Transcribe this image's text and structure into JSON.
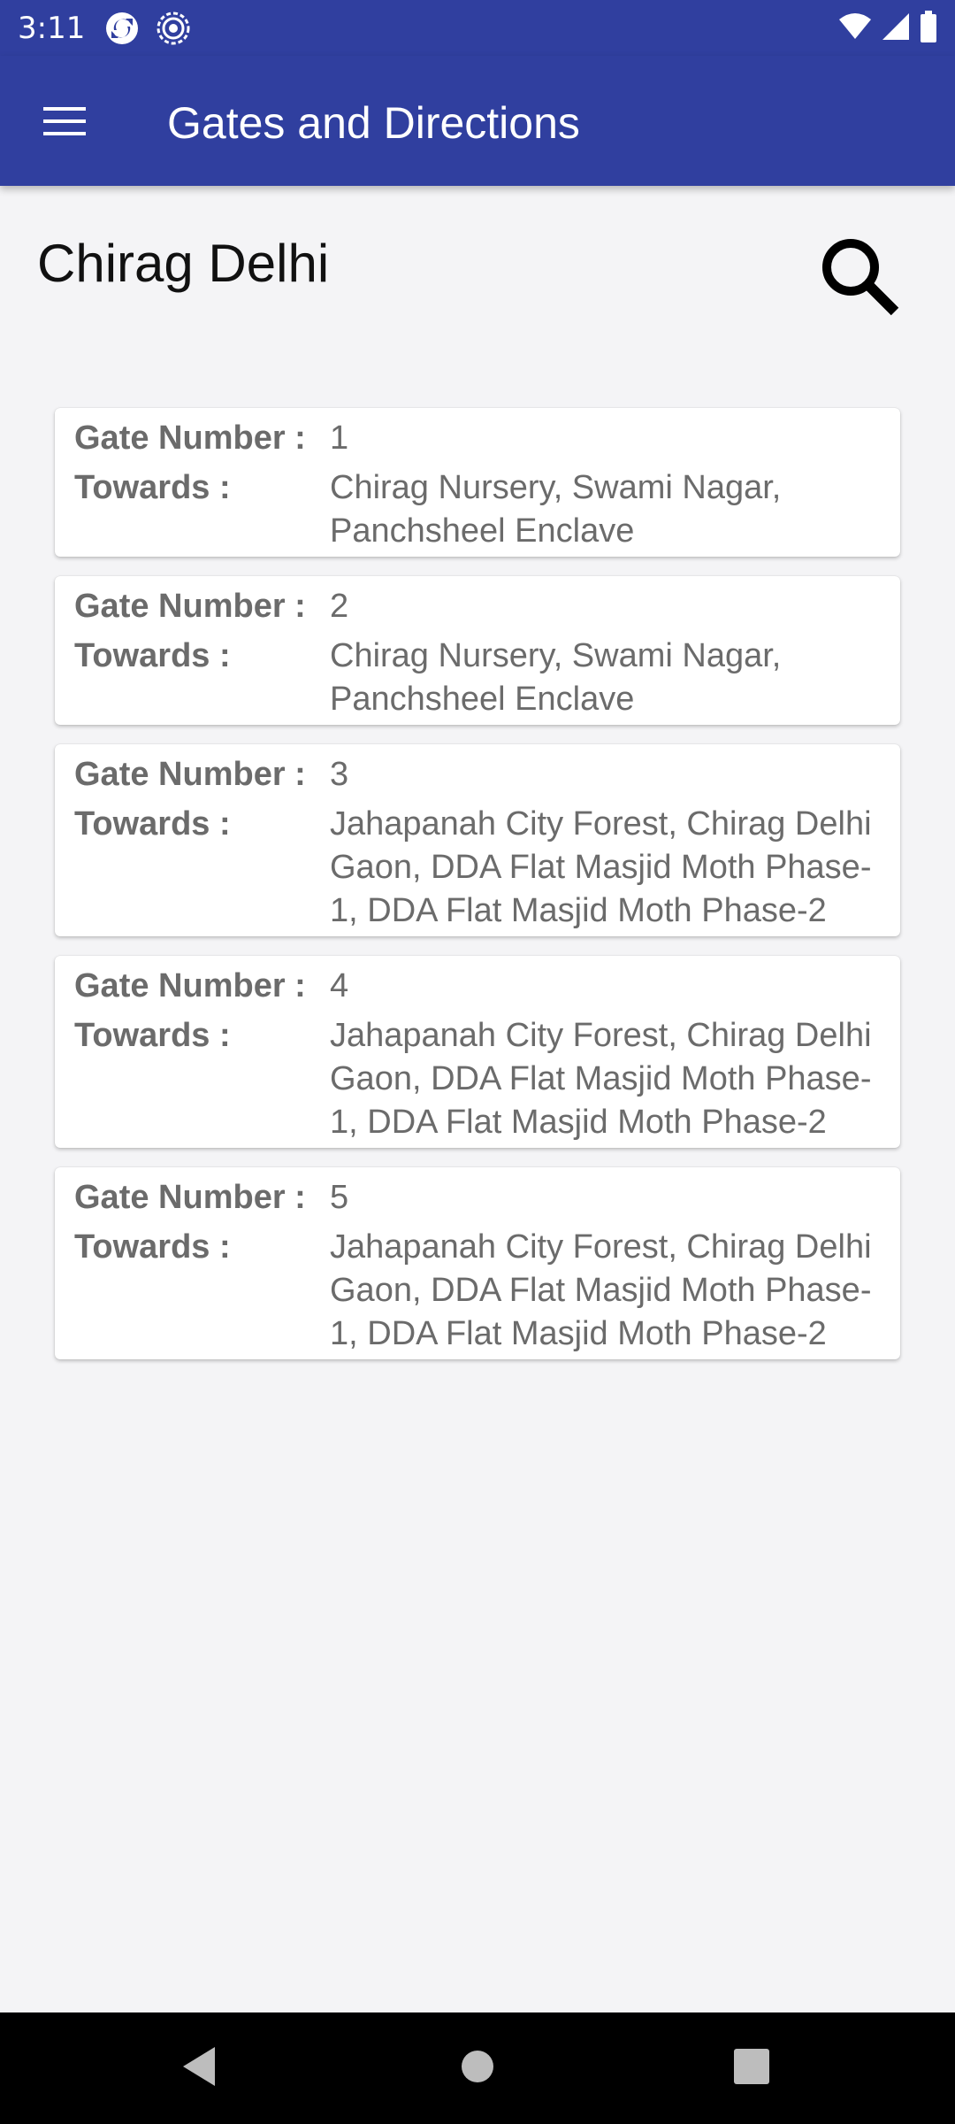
{
  "status_bar": {
    "time": "3:11",
    "left_icons": [
      "sync-icon",
      "settings-target-icon"
    ],
    "right_icons": [
      "wifi-icon",
      "signal-icon",
      "battery-icon"
    ]
  },
  "app_bar": {
    "title": "Gates and Directions",
    "menu_icon": "hamburger-menu-icon"
  },
  "station": {
    "name": "Chirag Delhi",
    "search_icon": "search-icon"
  },
  "labels": {
    "gate_number": "Gate Number :",
    "towards": "Towards :"
  },
  "gates": [
    {
      "number": "1",
      "towards": "Chirag Nursery, Swami Nagar, Panchsheel Enclave"
    },
    {
      "number": "2",
      "towards": "Chirag Nursery, Swami Nagar, Panchsheel Enclave"
    },
    {
      "number": "3",
      "towards": "Jahapanah City Forest, Chirag Delhi Gaon, DDA Flat Masjid Moth Phase-1, DDA Flat Masjid Moth Phase-2"
    },
    {
      "number": "4",
      "towards": "Jahapanah City Forest, Chirag Delhi Gaon, DDA Flat Masjid Moth Phase-1, DDA Flat Masjid Moth Phase-2"
    },
    {
      "number": "5",
      "towards": "Jahapanah City Forest, Chirag Delhi Gaon, DDA Flat Masjid Moth Phase-1, DDA Flat Masjid Moth Phase-2"
    }
  ],
  "nav_bar": {
    "icons": [
      "back-icon",
      "home-icon",
      "recents-icon"
    ]
  },
  "colors": {
    "primary": "#303f9f",
    "background": "#f4f4f6",
    "card": "#ffffff",
    "label_text": "#6b6b6b"
  }
}
